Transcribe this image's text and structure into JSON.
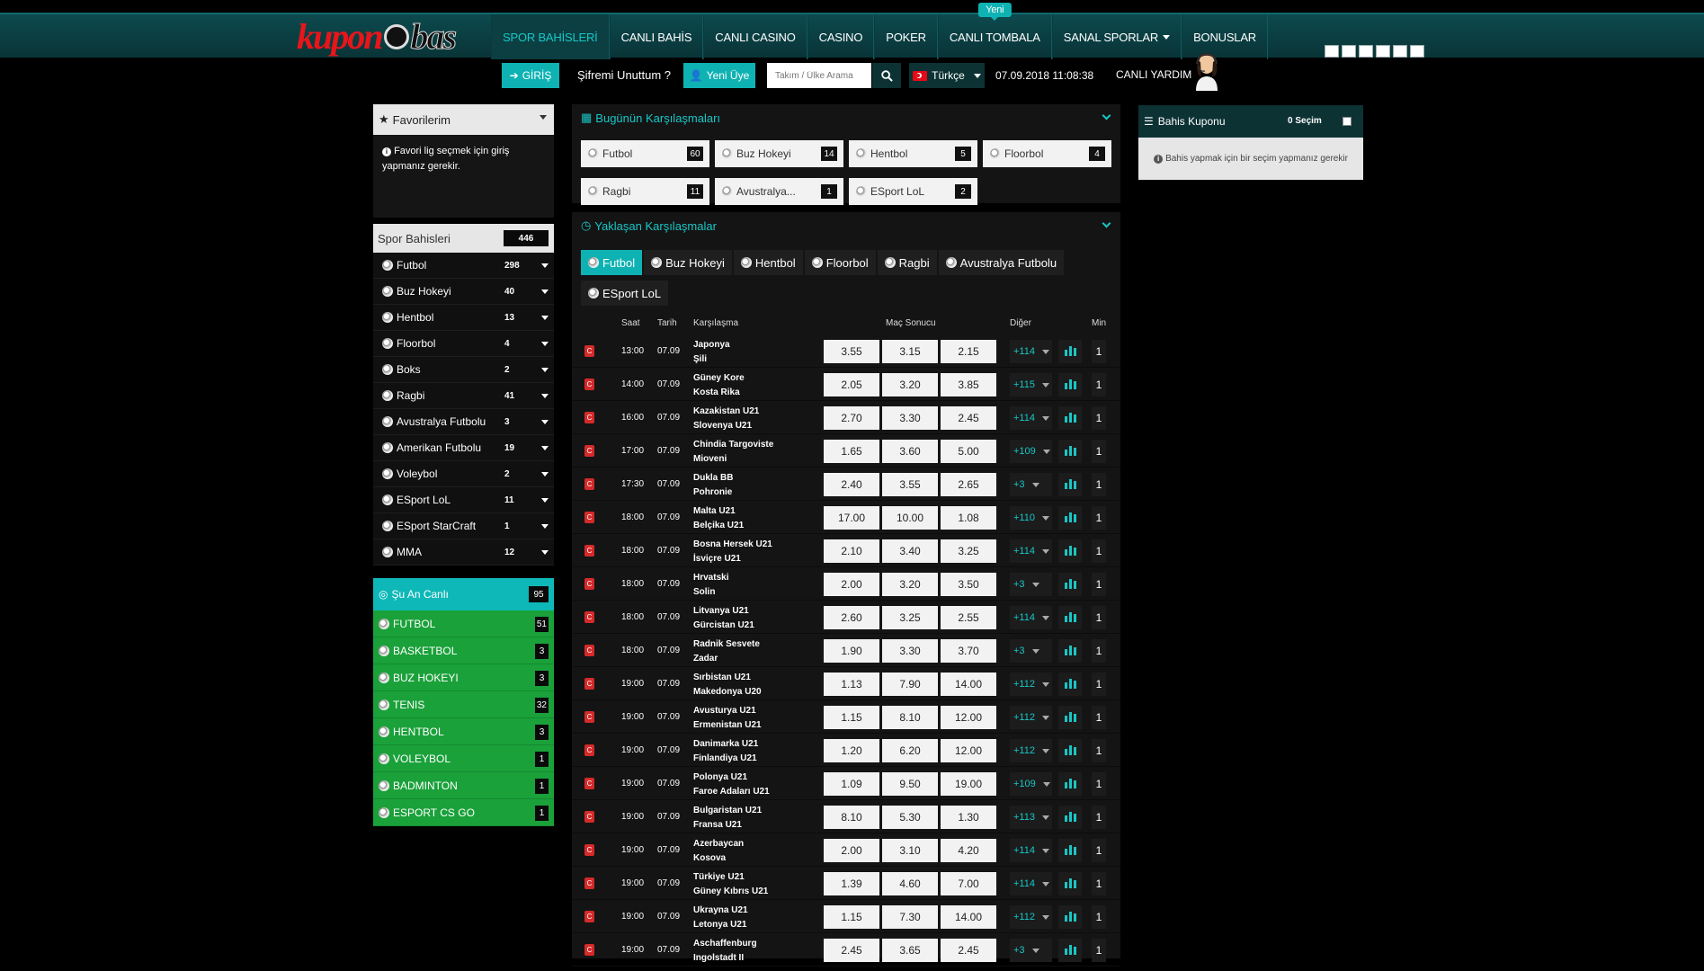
{
  "brand": {
    "logo_a": "kupon",
    "logo_b": "bas"
  },
  "nav": [
    {
      "label": "SPOR BAHİSLERİ",
      "active": true
    },
    {
      "label": "CANLI BAHİS"
    },
    {
      "label": "CANLI CASINO"
    },
    {
      "label": "CASINO"
    },
    {
      "label": "POKER"
    },
    {
      "label": "CANLI TOMBALA",
      "badge": "Yeni"
    },
    {
      "label": "SANAL SPORLAR",
      "dropdown": true
    },
    {
      "label": "BONUSLAR"
    }
  ],
  "header": {
    "login": "GİRİŞ",
    "forgot": "Şifremi Unuttum ?",
    "register": "Yeni Üye",
    "search_placeholder": "Takım / Ülke Arama",
    "language": "Türkçe",
    "datetime": "07.09.2018 11:08:38",
    "live_help": "CANLI YARDIM"
  },
  "favorites": {
    "title": "Favorilerim",
    "message": "Favori lig seçmek için giriş yapmanız gerekir."
  },
  "sports": {
    "title": "Spor Bahisleri",
    "count": "446",
    "items": [
      {
        "name": "Futbol",
        "count": "298"
      },
      {
        "name": "Buz Hokeyi",
        "count": "40"
      },
      {
        "name": "Hentbol",
        "count": "13"
      },
      {
        "name": "Floorbol",
        "count": "4"
      },
      {
        "name": "Boks",
        "count": "2"
      },
      {
        "name": "Ragbi",
        "count": "41"
      },
      {
        "name": "Avustralya Futbolu",
        "count": "3"
      },
      {
        "name": "Amerikan Futbolu",
        "count": "19"
      },
      {
        "name": "Voleybol",
        "count": "2"
      },
      {
        "name": "ESport LoL",
        "count": "11"
      },
      {
        "name": "ESport StarCraft",
        "count": "1"
      },
      {
        "name": "MMA",
        "count": "12"
      }
    ]
  },
  "live": {
    "title": "Şu An Canlı",
    "count": "95",
    "items": [
      {
        "name": "FUTBOL",
        "count": "51"
      },
      {
        "name": "BASKETBOL",
        "count": "3"
      },
      {
        "name": "BUZ HOKEYI",
        "count": "3"
      },
      {
        "name": "TENIS",
        "count": "32"
      },
      {
        "name": "HENTBOL",
        "count": "3"
      },
      {
        "name": "VOLEYBOL",
        "count": "1"
      },
      {
        "name": "BADMINTON",
        "count": "1"
      },
      {
        "name": "ESPORT CS GO",
        "count": "1"
      }
    ]
  },
  "today": {
    "title": "Bugünün Karşılaşmaları",
    "tiles": [
      {
        "name": "Futbol",
        "count": "60"
      },
      {
        "name": "Buz Hokeyi",
        "count": "14"
      },
      {
        "name": "Hentbol",
        "count": "5"
      },
      {
        "name": "Floorbol",
        "count": "4"
      },
      {
        "name": "Ragbi",
        "count": "11"
      },
      {
        "name": "Avustralya...",
        "count": "1"
      },
      {
        "name": "ESport LoL",
        "count": "2"
      }
    ]
  },
  "upcoming": {
    "title": "Yaklaşan Karşılaşmalar",
    "tabs": [
      "Futbol",
      "Buz Hokeyi",
      "Hentbol",
      "Floorbol",
      "Ragbi",
      "Avustralya Futbolu",
      "ESport LoL"
    ],
    "columns": {
      "time": "Saat",
      "date": "Tarih",
      "match": "Karşılaşma",
      "result": "Maç Sonucu",
      "other": "Diğer",
      "min": "Min"
    },
    "rows": [
      {
        "t": "13:00",
        "d": "07.09",
        "h": "Japonya",
        "a": "Şili",
        "o": [
          "3.55",
          "3.15",
          "2.15"
        ],
        "m": "+114",
        "n": "1"
      },
      {
        "t": "14:00",
        "d": "07.09",
        "h": "Güney Kore",
        "a": "Kosta Rika",
        "o": [
          "2.05",
          "3.20",
          "3.85"
        ],
        "m": "+115",
        "n": "1"
      },
      {
        "t": "16:00",
        "d": "07.09",
        "h": "Kazakistan U21",
        "a": "Slovenya U21",
        "o": [
          "2.70",
          "3.30",
          "2.45"
        ],
        "m": "+114",
        "n": "1"
      },
      {
        "t": "17:00",
        "d": "07.09",
        "h": "Chindia Targoviste",
        "a": "Mioveni",
        "o": [
          "1.65",
          "3.60",
          "5.00"
        ],
        "m": "+109",
        "n": "1"
      },
      {
        "t": "17:30",
        "d": "07.09",
        "h": "Dukla BB",
        "a": "Pohronie",
        "o": [
          "2.40",
          "3.55",
          "2.65"
        ],
        "m": "+3",
        "n": "1"
      },
      {
        "t": "18:00",
        "d": "07.09",
        "h": "Malta U21",
        "a": "Belçika U21",
        "o": [
          "17.00",
          "10.00",
          "1.08"
        ],
        "m": "+110",
        "n": "1"
      },
      {
        "t": "18:00",
        "d": "07.09",
        "h": "Bosna Hersek U21",
        "a": "İsviçre U21",
        "o": [
          "2.10",
          "3.40",
          "3.25"
        ],
        "m": "+114",
        "n": "1"
      },
      {
        "t": "18:00",
        "d": "07.09",
        "h": "Hrvatski",
        "a": "Solin",
        "o": [
          "2.00",
          "3.20",
          "3.50"
        ],
        "m": "+3",
        "n": "1"
      },
      {
        "t": "18:00",
        "d": "07.09",
        "h": "Litvanya U21",
        "a": "Gürcistan U21",
        "o": [
          "2.60",
          "3.25",
          "2.55"
        ],
        "m": "+114",
        "n": "1"
      },
      {
        "t": "18:00",
        "d": "07.09",
        "h": "Radnik Sesvete",
        "a": "Zadar",
        "o": [
          "1.90",
          "3.30",
          "3.70"
        ],
        "m": "+3",
        "n": "1"
      },
      {
        "t": "19:00",
        "d": "07.09",
        "h": "Sırbistan U21",
        "a": "Makedonya U20",
        "o": [
          "1.13",
          "7.90",
          "14.00"
        ],
        "m": "+112",
        "n": "1"
      },
      {
        "t": "19:00",
        "d": "07.09",
        "h": "Avusturya U21",
        "a": "Ermenistan U21",
        "o": [
          "1.15",
          "8.10",
          "12.00"
        ],
        "m": "+112",
        "n": "1"
      },
      {
        "t": "19:00",
        "d": "07.09",
        "h": "Danimarka U21",
        "a": "Finlandiya U21",
        "o": [
          "1.20",
          "6.20",
          "12.00"
        ],
        "m": "+112",
        "n": "1"
      },
      {
        "t": "19:00",
        "d": "07.09",
        "h": "Polonya U21",
        "a": "Faroe Adaları U21",
        "o": [
          "1.09",
          "9.50",
          "19.00"
        ],
        "m": "+109",
        "n": "1"
      },
      {
        "t": "19:00",
        "d": "07.09",
        "h": "Bulgaristan U21",
        "a": "Fransa U21",
        "o": [
          "8.10",
          "5.30",
          "1.30"
        ],
        "m": "+113",
        "n": "1"
      },
      {
        "t": "19:00",
        "d": "07.09",
        "h": "Azerbaycan",
        "a": "Kosova",
        "o": [
          "2.00",
          "3.10",
          "4.20"
        ],
        "m": "+114",
        "n": "1"
      },
      {
        "t": "19:00",
        "d": "07.09",
        "h": "Türkiye U21",
        "a": "Güney Kıbrıs U21",
        "o": [
          "1.39",
          "4.60",
          "7.00"
        ],
        "m": "+114",
        "n": "1"
      },
      {
        "t": "19:00",
        "d": "07.09",
        "h": "Ukrayna U21",
        "a": "Letonya U21",
        "o": [
          "1.15",
          "7.30",
          "14.00"
        ],
        "m": "+112",
        "n": "1"
      },
      {
        "t": "19:00",
        "d": "07.09",
        "h": "Aschaffenburg",
        "a": "Ingolstadt II",
        "o": [
          "2.45",
          "3.65",
          "2.45"
        ],
        "m": "+3",
        "n": "1"
      }
    ]
  },
  "coupon": {
    "title": "Bahis Kuponu",
    "selection": "0 Seçim",
    "message": "Bahis yapmak için bir seçim yapmanız gerekir"
  },
  "colors": {
    "accent": "#0fb2b3",
    "live_green": "#1aa13a",
    "nav_bg": "#0c4a4e"
  }
}
